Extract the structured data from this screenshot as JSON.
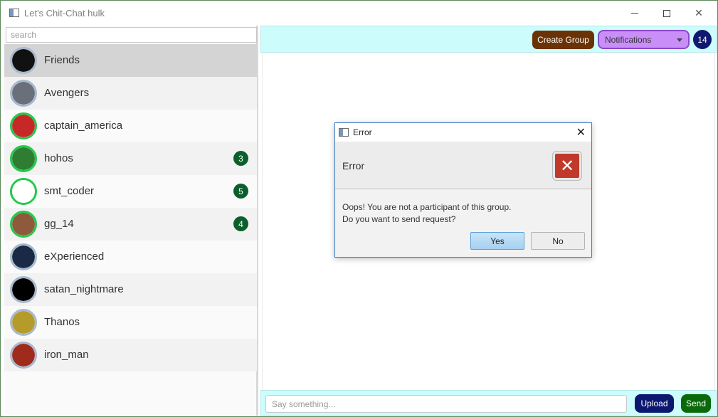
{
  "window": {
    "title": "Let's Chit-Chat hulk",
    "minimize_glyph": "",
    "close_glyph": "✕"
  },
  "sidebar": {
    "search_placeholder": "search",
    "items": [
      {
        "label": "Friends",
        "selected": true,
        "online": false,
        "badge": "",
        "avatar_color": "#111111"
      },
      {
        "label": "Avengers",
        "selected": false,
        "online": false,
        "badge": "",
        "avatar_color": "#6a6f7a"
      },
      {
        "label": "captain_america",
        "selected": false,
        "online": true,
        "badge": "",
        "avatar_color": "#c62828"
      },
      {
        "label": "hohos",
        "selected": false,
        "online": true,
        "badge": "3",
        "avatar_color": "#2e7d32"
      },
      {
        "label": "smt_coder",
        "selected": false,
        "online": true,
        "badge": "5",
        "avatar_color": "#ffffff"
      },
      {
        "label": "gg_14",
        "selected": false,
        "online": true,
        "badge": "4",
        "avatar_color": "#8d5a3c"
      },
      {
        "label": "eXperienced",
        "selected": false,
        "online": false,
        "badge": "",
        "avatar_color": "#1a2a44"
      },
      {
        "label": "satan_nightmare",
        "selected": false,
        "online": false,
        "badge": "",
        "avatar_color": "#000000"
      },
      {
        "label": "Thanos",
        "selected": false,
        "online": false,
        "badge": "",
        "avatar_color": "#b59b2a"
      },
      {
        "label": "iron_man",
        "selected": false,
        "online": false,
        "badge": "",
        "avatar_color": "#a02a1c"
      }
    ]
  },
  "toolbar": {
    "create_group_label": "Create Group",
    "notifications_label": "Notifications",
    "count": "14"
  },
  "composer": {
    "placeholder": "Say something...",
    "upload_label": "Upload",
    "send_label": "Send"
  },
  "dialog": {
    "title": "Error",
    "header": "Error",
    "message_line1": "Oops! You are not a participant of this group.",
    "message_line2": "Do you want to send request?",
    "yes_label": "Yes",
    "no_label": "No",
    "icon": "error-icon"
  },
  "colors": {
    "accent_cyan": "#ccfcfc",
    "create_group": "#6a3306",
    "notifications": "#c98ef7",
    "count_pill": "#101870",
    "upload": "#0c1870",
    "send": "#0a6a0a",
    "badge": "#0b5f2c",
    "online_ring": "#22c94a"
  }
}
